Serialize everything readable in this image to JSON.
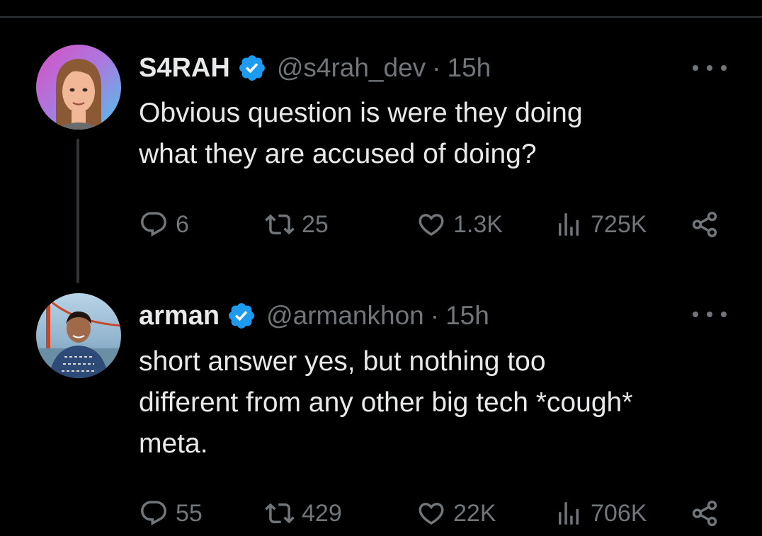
{
  "tweets": [
    {
      "name": "S4RAH",
      "handle": "@s4rah_dev",
      "separator": "·",
      "time": "15h",
      "text_lines": [
        "Obvious question is were they doing",
        "what they are accused of doing?"
      ],
      "replies": "6",
      "retweets": "25",
      "likes": "1.3K",
      "views": "725K"
    },
    {
      "name": "arman",
      "handle": "@armankhon",
      "separator": "·",
      "time": "15h",
      "text_lines": [
        "short answer yes, but nothing too",
        "different from any other big tech *cough*",
        "meta."
      ],
      "replies": "55",
      "retweets": "429",
      "likes": "22K",
      "views": "706K"
    }
  ],
  "colors": {
    "background": "#000000",
    "text": "#e7e9ea",
    "muted": "#71767b",
    "verified_blue": "#1d9bf0",
    "thread_line": "#333639"
  },
  "icons": [
    "verified-badge-icon",
    "more-options-icon",
    "reply-icon",
    "retweet-icon",
    "like-icon",
    "views-icon",
    "share-icon"
  ]
}
